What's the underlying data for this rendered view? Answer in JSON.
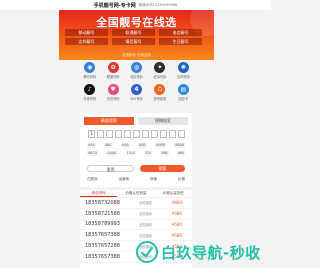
{
  "header": {
    "title": "手机靓号网-专卡网",
    "subtitle": "客服手机13260099686"
  },
  "banner": {
    "title": "全国靓号在线选",
    "tags": [
      "移动靓号",
      "联通靓号",
      "电信靓号",
      "吉祥靓号",
      "情侣靓号",
      "生日靓号"
    ],
    "subtitle": "全国靓号 在线选购"
  },
  "icons": [
    {
      "label": "移动号码",
      "icon": "mobile-icon",
      "color": "#2f7fd8",
      "glyph": "◉"
    },
    {
      "label": "联通号码",
      "icon": "unicom-icon",
      "color": "#d93a2b",
      "glyph": "✿"
    },
    {
      "label": "电信号码",
      "icon": "telecom-icon",
      "color": "#3a7ee0",
      "glyph": "◍"
    },
    {
      "label": "虚拟号码",
      "icon": "virtual-icon",
      "color": "#2d2d2d",
      "glyph": "✦"
    },
    {
      "label": "吉祥号码",
      "icon": "lucky-icon",
      "color": "#1f64c8",
      "glyph": "✺"
    },
    {
      "label": "抖音号码",
      "icon": "tiktok-icon",
      "color": "#111111",
      "glyph": "♪"
    },
    {
      "label": "情侣号码",
      "icon": "couple-icon",
      "color": "#e84a8a",
      "glyph": "♥"
    },
    {
      "label": "400号码",
      "icon": "number-400-icon",
      "color": "#2f5fcc",
      "glyph": "4"
    },
    {
      "label": "靓号回收",
      "icon": "recycle-icon",
      "color": "#e9621e",
      "glyph": "♺"
    },
    {
      "label": "回复卡",
      "icon": "card-icon",
      "color": "#2a88d8",
      "glyph": "▤"
    }
  ],
  "search": {
    "tabs": [
      "精准搜索",
      "模糊搜索"
    ],
    "digits": [
      "1",
      "",
      "",
      "",
      "",
      "",
      "",
      "",
      "",
      "",
      ""
    ],
    "keys": [
      [
        "AAA",
        "ABC",
        "AAB",
        "ABB",
        "AABB",
        "ABAB"
      ],
      [
        "ABCD",
        "AAAA",
        "1314",
        "520",
        "888",
        "666"
      ]
    ],
    "reset_label": "重置",
    "search_label": "搜索",
    "filters": [
      "归属地",
      "运营商",
      "规律",
      "价格"
    ]
  },
  "list": {
    "headers": [
      "综合排序",
      "价格从低到高",
      "价格从高到低"
    ],
    "rows": [
      {
        "number": "18358732088",
        "info": "全国通用",
        "price": "¥880"
      },
      {
        "number": "18358721588",
        "info": "全国通用",
        "price": "¥580"
      },
      {
        "number": "18358789993",
        "info": "全国通用",
        "price": "¥580"
      },
      {
        "number": "18357657388",
        "info": "全国通用",
        "price": "¥580"
      },
      {
        "number": "18357657288",
        "info": "全国通用",
        "price": "¥580"
      },
      {
        "number": "18357657388",
        "info": "全国通用",
        "price": "¥580"
      }
    ]
  },
  "watermark": {
    "text": "白玖导航-秒收",
    "color": "#23c0a6"
  }
}
